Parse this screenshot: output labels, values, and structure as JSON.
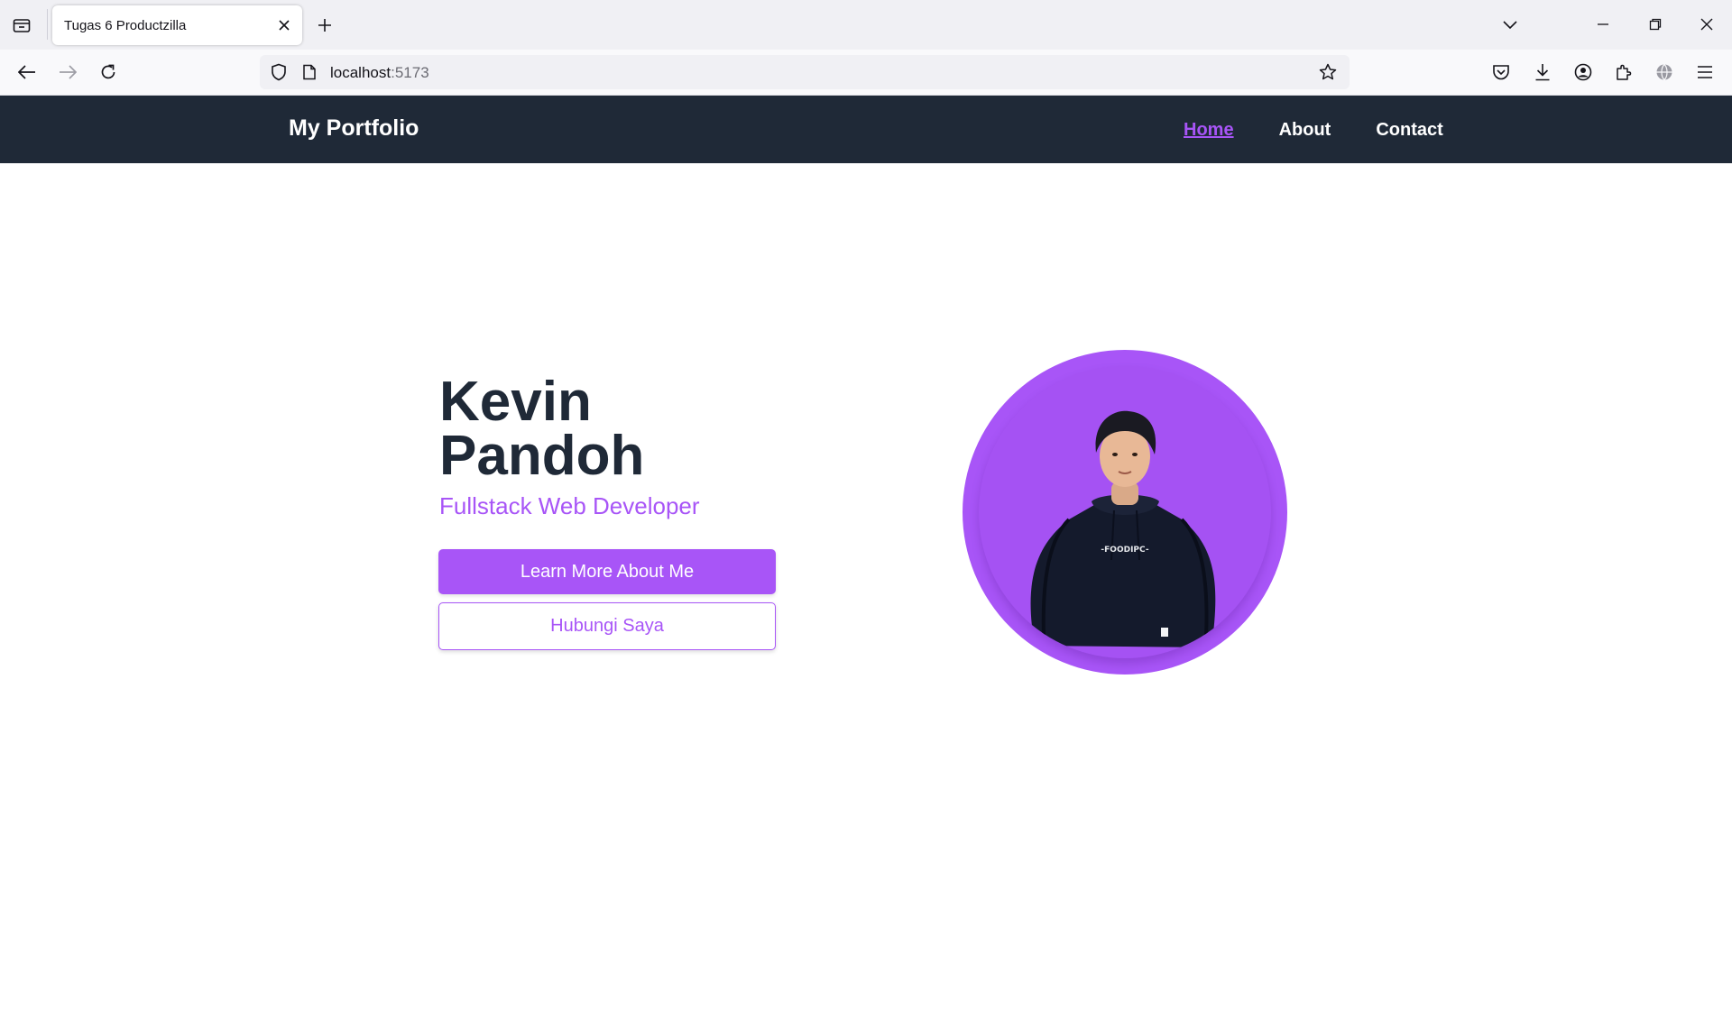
{
  "browser": {
    "tab_title": "Tugas 6 Productzilla",
    "url_host": "localhost",
    "url_port": ":5173"
  },
  "site": {
    "brand": "My Portfolio",
    "nav": [
      {
        "label": "Home",
        "active": true
      },
      {
        "label": "About",
        "active": false
      },
      {
        "label": "Contact",
        "active": false
      }
    ],
    "hero": {
      "first_name": "Kevin",
      "last_name": "Pandoh",
      "role": "Fullstack Web Developer",
      "primary_button": "Learn More About Me",
      "secondary_button": "Hubungi Saya",
      "hoodie_text": "-FOODIPC-"
    }
  },
  "colors": {
    "header_bg": "#1f2937",
    "accent": "#a855f7",
    "heading": "#1f2937"
  },
  "icons": {
    "tab_list": "tab-list-icon",
    "close_tab": "close-icon",
    "new_tab": "plus-icon",
    "back": "back-arrow-icon",
    "forward": "forward-arrow-icon",
    "reload": "reload-icon",
    "shield": "shield-icon",
    "page": "page-icon",
    "bookmark": "star-icon",
    "pocket": "pocket-icon",
    "downloads": "download-icon",
    "account": "account-icon",
    "extensions": "extensions-icon",
    "translate": "globe-icon",
    "menu": "hamburger-menu-icon"
  }
}
